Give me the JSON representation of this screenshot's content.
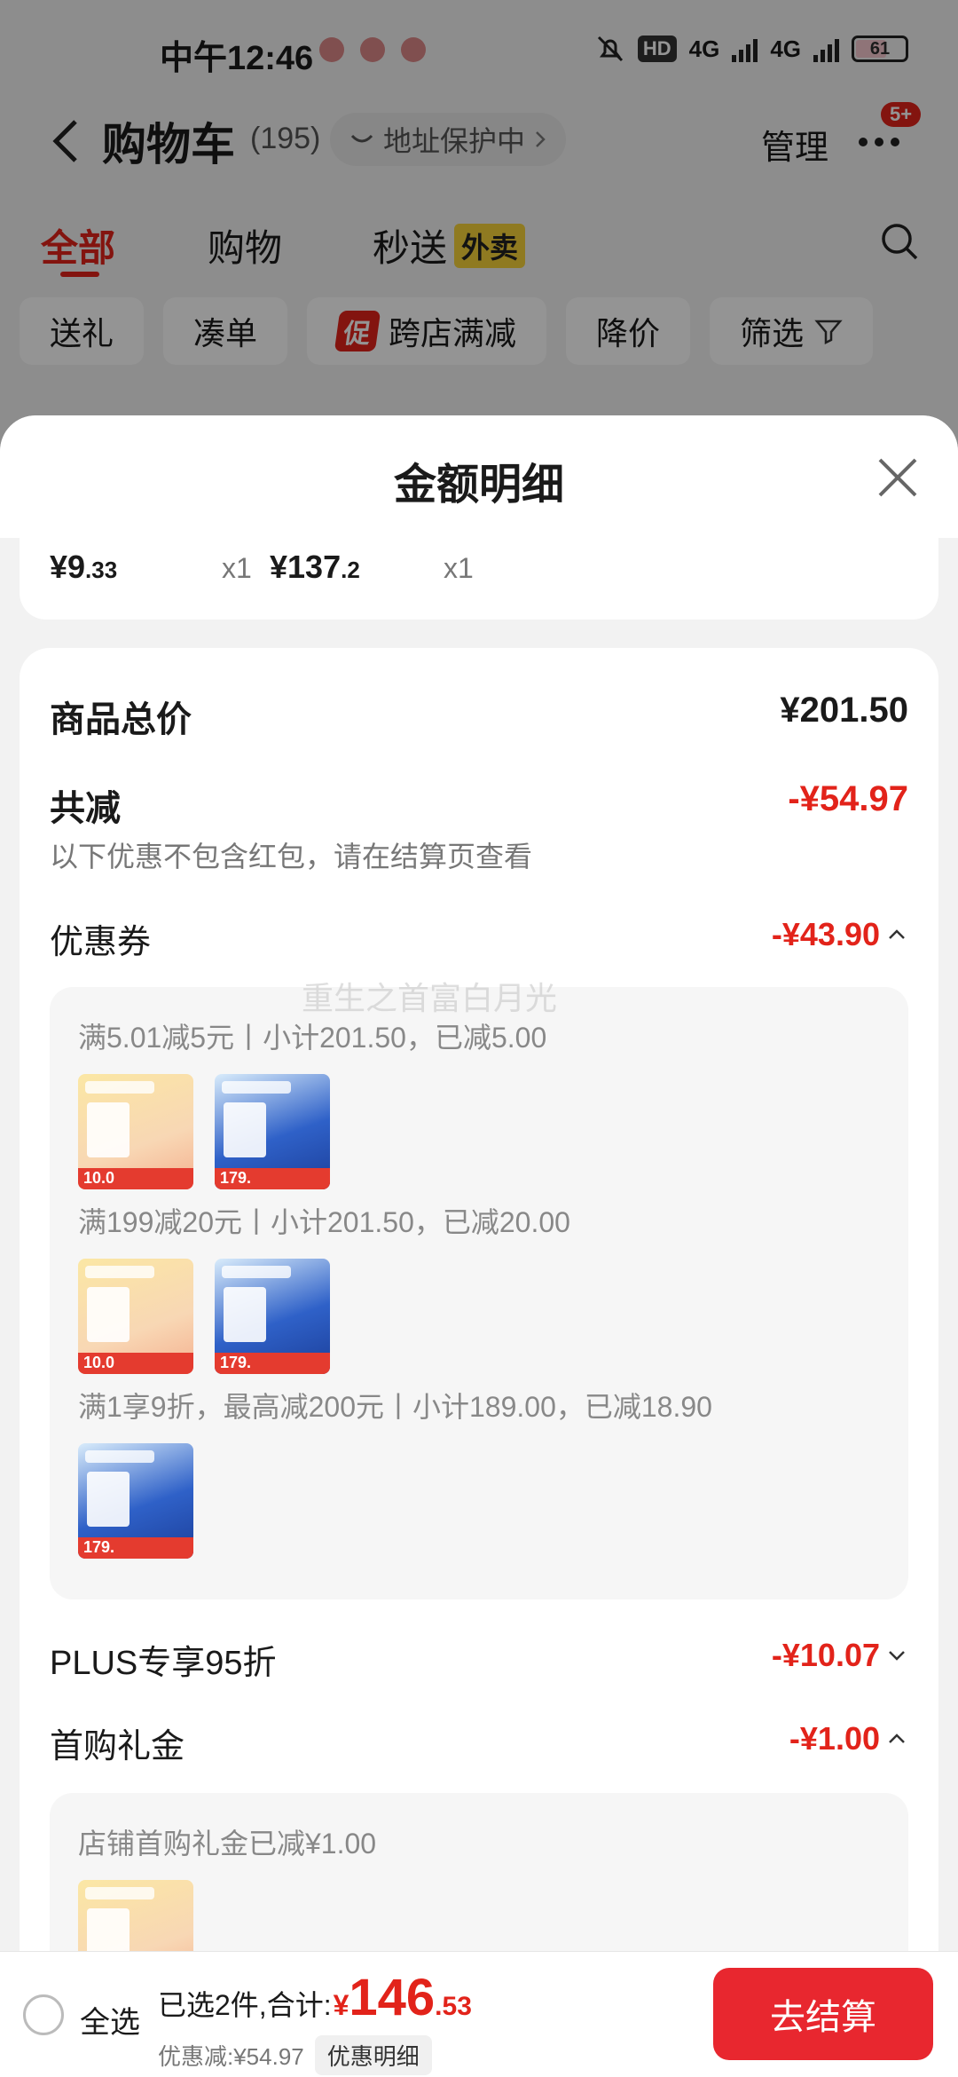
{
  "status_bar": {
    "time": "中午12:46",
    "hd_label": "HD",
    "net_label_1": "4G",
    "net_label_2": "4G",
    "battery": "61"
  },
  "nav": {
    "title": "购物车",
    "count": "(195)",
    "address_protect": "地址保护中",
    "manage": "管理",
    "badge": "5+"
  },
  "tabs": {
    "all": "全部",
    "shopping": "购物",
    "flash": "秒送",
    "waimai": "外卖"
  },
  "chips": {
    "gift": "送礼",
    "bundle": "凑单",
    "promo_tag": "促",
    "cross_store": "跨店满减",
    "price_drop": "降价",
    "filter": "筛选"
  },
  "sheet": {
    "title": "金额明细",
    "items": [
      {
        "price_int": "¥9",
        "price_dec": ".33",
        "qty": "x1"
      },
      {
        "price_int": "¥137",
        "price_dec": ".2",
        "qty": "x1"
      }
    ],
    "total_label": "商品总价",
    "total_value": "¥201.50",
    "reduce_label": "共减",
    "reduce_value": "-¥54.97",
    "reduce_note": "以下优惠不包含红包，请在结算页查看",
    "coupon_label": "优惠券",
    "coupon_value": "-¥43.90",
    "coupon_rules": [
      "满5.01减5元丨小计201.50，已减5.00",
      "满199减20元丨小计201.50，已减20.00",
      "满1享9折，最高减200元丨小计189.00，已减18.90"
    ],
    "thumb_prices": {
      "yellow": "10.0",
      "blue": "179."
    },
    "plus_label": "PLUS专享95折",
    "plus_value": "-¥10.07",
    "firstbuy_label": "首购礼金",
    "firstbuy_value": "-¥1.00",
    "firstbuy_note": "店铺首购礼金已减¥1.00",
    "watermark": "重生之首富白月光"
  },
  "bottom": {
    "select_all": "全选",
    "selected_text": "已选2件,合计:",
    "yen": "¥",
    "total_int": "146",
    "total_dec": ".53",
    "discount_text": "优惠减:¥54.97",
    "detail_btn": "优惠明细",
    "checkout": "去结算"
  },
  "colors": {
    "accent_red": "#e2231a",
    "checkout_red": "#e8272f",
    "waimai_yellow": "#f6d23a"
  }
}
